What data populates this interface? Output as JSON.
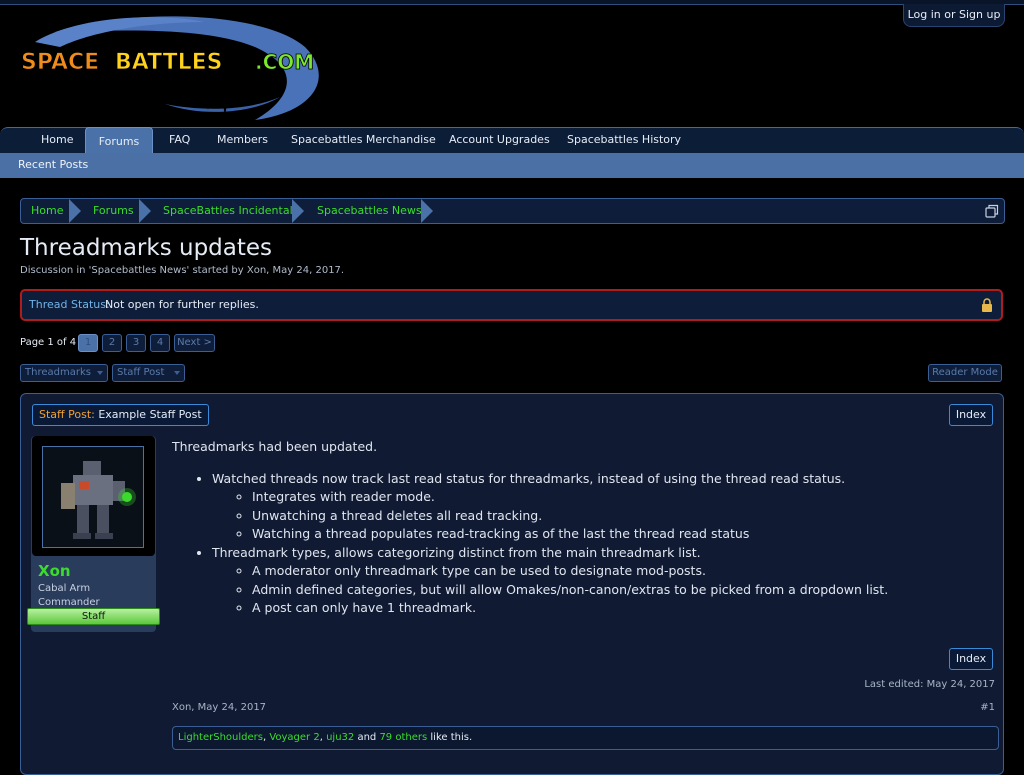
{
  "header": {
    "login_label": "Log in or Sign up",
    "logo_text_a": "SPACE",
    "logo_text_b": "BATTLES",
    "logo_text_c": ".COM"
  },
  "nav": {
    "tabs": [
      "Home",
      "Forums",
      "FAQ",
      "Members",
      "Spacebattles Merchandise",
      "Account Upgrades",
      "Spacebattles History"
    ],
    "active_tab": "Forums",
    "subnav_item": "Recent Posts"
  },
  "breadcrumb": [
    "Home",
    "Forums",
    "SpaceBattles Incidentals",
    "Spacebattles News"
  ],
  "thread": {
    "title": "Threadmarks updates",
    "description": "Discussion in 'Spacebattles News' started by Xon, May 24, 2017.",
    "status_label": "Thread Status:",
    "status_value": "Not open for further replies."
  },
  "pager": {
    "label": "Page 1 of 4",
    "pages": [
      "1",
      "2",
      "3",
      "4"
    ],
    "current": "1",
    "next_label": "Next >"
  },
  "toolbar": {
    "threadmarks_label": "Threadmarks",
    "staff_post_label": "Staff Post",
    "reader_mode_label": "Reader Mode"
  },
  "post": {
    "threadmark_kind": "Staff Post:",
    "threadmark_title": "Example Staff Post",
    "index_label": "Index",
    "author": {
      "name": "Xon",
      "title_line1": "Cabal Arm",
      "title_line2": "Commander",
      "badge": "Staff"
    },
    "intro": "Threadmarks had been updated.",
    "bullets": [
      {
        "text": "Watched threads now track last read status for threadmarks, instead of using the thread read status.",
        "sub": [
          "Integrates with reader mode.",
          "Unwatching a thread deletes all read tracking.",
          "Watching a thread populates read-tracking as of the last the thread read status"
        ]
      },
      {
        "text": "Threadmark types, allows categorizing distinct from the main threadmark list.",
        "sub": [
          "A moderator only threadmark type can be used to designate mod-posts.",
          "Admin defined categories, but will allow Omakes/non-canon/extras to be picked from a dropdown list.",
          "A post can only have 1 threadmark."
        ]
      }
    ],
    "last_edited": "Last edited: May 24, 2017",
    "meta": "Xon, May 24, 2017",
    "number": "#1",
    "likes": {
      "users": [
        "LighterShoulders",
        "Voyager 2",
        "uju32"
      ],
      "others": "79 others",
      "sep": ", ",
      "and_word": " and ",
      "suffix": " like this."
    }
  },
  "colors": {
    "link_green": "#3bdc2c",
    "nav_blue": "#4a70a6",
    "status_border": "#b01c1c",
    "threadmark_orange": "#f0a030"
  }
}
